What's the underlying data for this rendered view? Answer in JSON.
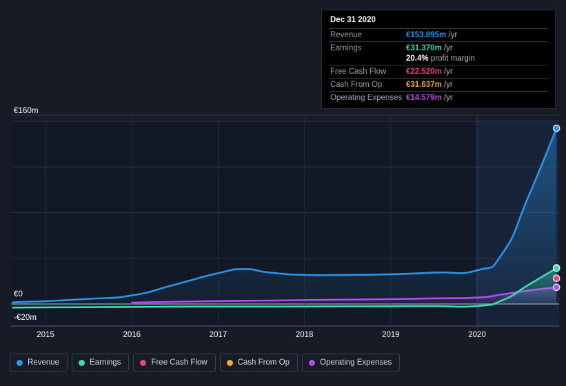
{
  "tooltip": {
    "title": "Dec 31 2020",
    "rows": [
      {
        "label": "Revenue",
        "amount": "€153.895m",
        "unit": "/yr",
        "color": "#2b95e8"
      },
      {
        "label": "Earnings",
        "amount": "€31.370m",
        "unit": "/yr",
        "color": "#3ddcb0"
      },
      {
        "label": "Free Cash Flow",
        "amount": "€22.520m",
        "unit": "/yr",
        "color": "#e8457f"
      },
      {
        "label": "Cash From Op",
        "amount": "€31.637m",
        "unit": "/yr",
        "color": "#f0a73c"
      },
      {
        "label": "Operating Expenses",
        "amount": "€14.579m",
        "unit": "/yr",
        "color": "#b44bf0"
      }
    ],
    "profit_margin_value": "20.4%",
    "profit_margin_label": "profit margin"
  },
  "legend": {
    "items": [
      {
        "label": "Revenue",
        "color": "#2b95e8"
      },
      {
        "label": "Earnings",
        "color": "#3ddcb0"
      },
      {
        "label": "Free Cash Flow",
        "color": "#e8457f"
      },
      {
        "label": "Cash From Op",
        "color": "#f0a73c"
      },
      {
        "label": "Operating Expenses",
        "color": "#b44bf0"
      }
    ]
  },
  "axis": {
    "y_top_label": "€160m",
    "y_zero_label": "€0",
    "y_bottom_label": "-€20m",
    "x_labels": [
      "2015",
      "2016",
      "2017",
      "2018",
      "2019",
      "2020"
    ]
  },
  "chart_data": {
    "type": "area",
    "title": "",
    "xlabel": "",
    "ylabel": "",
    "ylim": [
      -20,
      160
    ],
    "xlim": [
      2014.6,
      2020.95
    ],
    "grid": true,
    "legend_position": "bottom",
    "y_ticks": [
      160,
      120,
      80,
      40,
      0,
      -20
    ],
    "x_ticks": [
      2015,
      2016,
      2017,
      2018,
      2019,
      2020
    ],
    "highlight_x": 2020,
    "x": [
      2014.62,
      2015.0,
      2015.5,
      2016.0,
      2016.5,
      2017.0,
      2017.3,
      2017.6,
      2018.0,
      2018.5,
      2019.0,
      2019.5,
      2020.0,
      2020.3,
      2020.6,
      2020.92
    ],
    "series": [
      {
        "name": "Revenue",
        "color": "#2b95e8",
        "values": [
          1.5,
          2.5,
          4.5,
          7.5,
          17.0,
          27.0,
          30.5,
          27.5,
          25.5,
          25.5,
          26.0,
          27.5,
          29.5,
          45.0,
          95.0,
          153.895
        ]
      },
      {
        "name": "Earnings",
        "color": "#3ddcb0",
        "values": [
          -3.2,
          -3.0,
          -2.8,
          -2.6,
          -2.4,
          -2.3,
          -2.3,
          -2.3,
          -2.2,
          -2.1,
          -2.0,
          -1.9,
          -1.8,
          3.5,
          17.0,
          31.37
        ]
      },
      {
        "name": "Free Cash Flow",
        "color": "#e8457f",
        "values": [
          null,
          null,
          null,
          null,
          null,
          null,
          null,
          null,
          null,
          null,
          null,
          null,
          null,
          null,
          null,
          22.52
        ]
      },
      {
        "name": "Cash From Op",
        "color": "#f0a73c",
        "values": [
          null,
          null,
          null,
          null,
          null,
          null,
          null,
          null,
          null,
          null,
          null,
          null,
          null,
          null,
          null,
          31.637
        ]
      },
      {
        "name": "Operating Expenses",
        "color": "#b44bf0",
        "values": [
          null,
          null,
          null,
          1.2,
          1.9,
          2.6,
          2.8,
          3.0,
          3.4,
          3.8,
          4.3,
          4.9,
          5.6,
          8.5,
          11.8,
          14.579
        ]
      }
    ],
    "endpoints": [
      {
        "name": "Revenue",
        "value": 153.895,
        "color": "#2b95e8"
      },
      {
        "name": "Cash From Op",
        "value": 31.637,
        "color": "#f0a73c"
      },
      {
        "name": "Earnings",
        "value": 31.37,
        "color": "#3ddcb0"
      },
      {
        "name": "Free Cash Flow",
        "value": 22.52,
        "color": "#e8457f"
      },
      {
        "name": "Operating Expenses",
        "value": 14.579,
        "color": "#b44bf0"
      }
    ]
  }
}
